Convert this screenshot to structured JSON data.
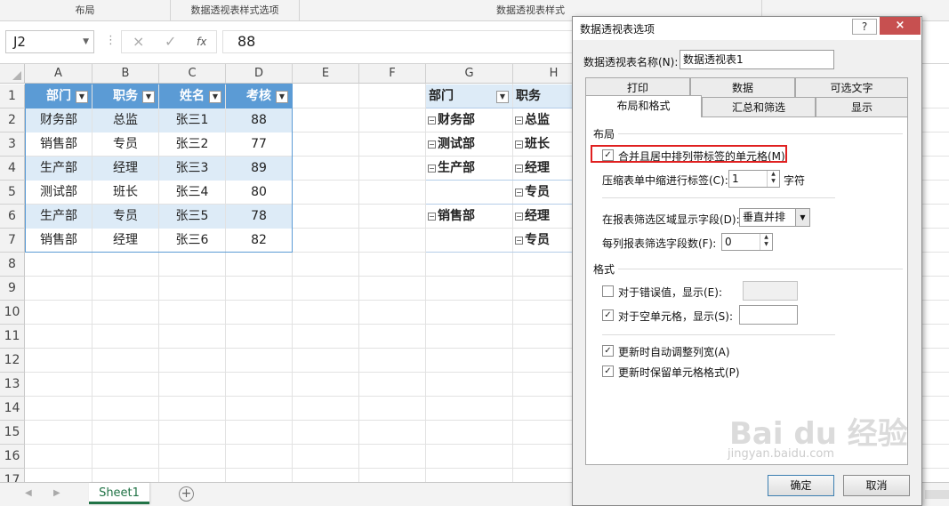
{
  "ribbon": {
    "groups": [
      "布局",
      "数据透视表样式选项",
      "数据透视表样式"
    ]
  },
  "formula_bar": {
    "name_box": "J2",
    "cancel_icon": "×",
    "enter_icon": "✓",
    "fx": "fx",
    "value": "88"
  },
  "sheet": {
    "columns": [
      "A",
      "B",
      "C",
      "D",
      "E",
      "F",
      "G",
      "H"
    ],
    "rows": [
      "1",
      "2",
      "3",
      "4",
      "5",
      "6",
      "7",
      "8",
      "9",
      "10",
      "11",
      "12",
      "13",
      "14",
      "15",
      "16",
      "17"
    ],
    "table": {
      "headers": [
        "部门",
        "职务",
        "姓名",
        "考核"
      ],
      "rows": [
        [
          "财务部",
          "总监",
          "张三1",
          "88"
        ],
        [
          "销售部",
          "专员",
          "张三2",
          "77"
        ],
        [
          "生产部",
          "经理",
          "张三3",
          "89"
        ],
        [
          "测试部",
          "班长",
          "张三4",
          "80"
        ],
        [
          "生产部",
          "专员",
          "张三5",
          "78"
        ],
        [
          "销售部",
          "经理",
          "张三6",
          "82"
        ]
      ]
    },
    "pivot": {
      "headers": [
        "部门",
        "职务"
      ],
      "rows": [
        [
          "财务部",
          "总监"
        ],
        [
          "测试部",
          "班长"
        ],
        [
          "生产部",
          "经理"
        ],
        [
          "",
          "专员"
        ],
        [
          "销售部",
          "经理"
        ],
        [
          "",
          "专员"
        ]
      ]
    },
    "tab_name": "Sheet1",
    "add_sheet": "+"
  },
  "dialog": {
    "title": "数据透视表选项",
    "help": "?",
    "close": "×",
    "name_label": "数据透视表名称(N):",
    "name_value": "数据透视表1",
    "tabs_row1": [
      "打印",
      "数据",
      "可选文字"
    ],
    "tabs_row2": [
      "布局和格式",
      "汇总和筛选",
      "显示"
    ],
    "active_tab": "布局和格式",
    "layout_section": "布局",
    "merge_label": "合并且居中排列带标签的单元格(M)",
    "merge_checked": true,
    "indent_label": "压缩表单中缩进行标签(C):",
    "indent_value": "1",
    "indent_unit": "字符",
    "filter_area_label": "在报表筛选区域显示字段(D):",
    "filter_area_value": "垂直并排",
    "filter_count_label": "每列报表筛选字段数(F):",
    "filter_count_value": "0",
    "format_section": "格式",
    "error_label": "对于错误值，显示(E):",
    "error_checked": false,
    "empty_label": "对于空单元格，显示(S):",
    "empty_checked": true,
    "autofit_label": "更新时自动调整列宽(A)",
    "autofit_checked": true,
    "preserve_label": "更新时保留单元格格式(P)",
    "preserve_checked": true,
    "ok": "确定",
    "cancel": "取消"
  },
  "watermark": {
    "logo": "Bai du 经验",
    "url": "jingyan.baidu.com"
  }
}
